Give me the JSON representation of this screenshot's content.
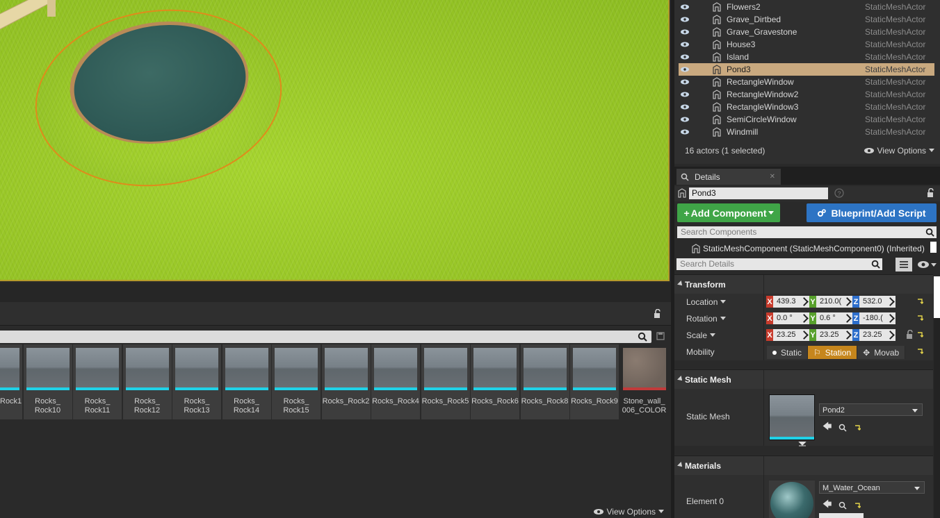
{
  "outliner": {
    "rows": [
      {
        "name": "Flowers2",
        "type": "StaticMeshActor",
        "selected": false
      },
      {
        "name": "Grave_Dirtbed",
        "type": "StaticMeshActor",
        "selected": false
      },
      {
        "name": "Grave_Gravestone",
        "type": "StaticMeshActor",
        "selected": false
      },
      {
        "name": "House3",
        "type": "StaticMeshActor",
        "selected": false
      },
      {
        "name": "Island",
        "type": "StaticMeshActor",
        "selected": false
      },
      {
        "name": "Pond3",
        "type": "StaticMeshActor",
        "selected": true
      },
      {
        "name": "RectangleWindow",
        "type": "StaticMeshActor",
        "selected": false
      },
      {
        "name": "RectangleWindow2",
        "type": "StaticMeshActor",
        "selected": false
      },
      {
        "name": "RectangleWindow3",
        "type": "StaticMeshActor",
        "selected": false
      },
      {
        "name": "SemiCircleWindow",
        "type": "StaticMeshActor",
        "selected": false
      },
      {
        "name": "Windmill",
        "type": "StaticMeshActor",
        "selected": false
      }
    ],
    "footer": "16 actors (1 selected)",
    "view_options": "View Options"
  },
  "details": {
    "tab_label": "Details",
    "actor_name": "Pond3",
    "add_component": "Add Component",
    "blueprint": "Blueprint/Add Script",
    "search_components_placeholder": "Search Components",
    "component_label": "StaticMeshComponent (StaticMeshComponent0) (Inherited)",
    "search_details_placeholder": "Search Details",
    "transform": {
      "title": "Transform",
      "location_label": "Location",
      "location": {
        "x": "439.3",
        "y": "210.0(",
        "z": "532.0"
      },
      "rotation_label": "Rotation",
      "rotation": {
        "x": "0.0 °",
        "y": "0.6 °",
        "z": "-180.("
      },
      "scale_label": "Scale",
      "scale": {
        "x": "23.25",
        "y": "23.25",
        "z": "23.25"
      },
      "mobility_label": "Mobility",
      "mobility": {
        "static": "Static",
        "stationary": "Station",
        "movable": "Movab"
      }
    },
    "static_mesh": {
      "title": "Static Mesh",
      "label": "Static Mesh",
      "value": "Pond2"
    },
    "materials": {
      "title": "Materials",
      "element_label": "Element 0",
      "value": "M_Water_Ocean"
    }
  },
  "content_browser": {
    "assets": [
      "Rock1",
      "Rocks_\nRock10",
      "Rocks_\nRock11",
      "Rocks_\nRock12",
      "Rocks_\nRock13",
      "Rocks_\nRock14",
      "Rocks_\nRock15",
      "Rocks_Rock2",
      "Rocks_Rock4",
      "Rocks_Rock5",
      "Rocks_Rock6",
      "Rocks_Rock8",
      "Rocks_Rock9",
      "Stone_wall_\n006_COLOR"
    ],
    "view_options": "View Options"
  },
  "colors": {
    "selection": "#c9a97f",
    "add_component": "#3fa547",
    "blueprint": "#2d74c4",
    "mobility_active": "#c6861d",
    "pond_outline": "#e08b1b"
  }
}
